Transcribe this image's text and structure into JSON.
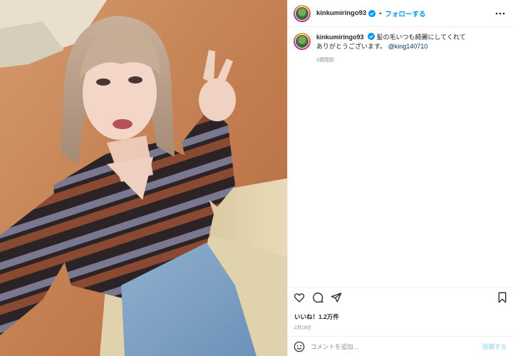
{
  "post": {
    "username": "kinkumiringo93",
    "follow_label": "フォローする",
    "separator": "•",
    "caption_line1": "髪の毛いつも綺麗にしてくれて",
    "caption_line2": "ありがとうございます。",
    "caption_mention": "@king140710",
    "caption_time": "3週間前",
    "likes": "いいね！1.2万件",
    "date": "2月18日",
    "comment_placeholder": "コメントを追加...",
    "post_label": "投稿する"
  },
  "icons": {
    "verified": "verified-badge-icon",
    "more": "more-options-icon",
    "like": "heart-icon",
    "comment": "comment-icon",
    "share": "share-icon",
    "save": "bookmark-icon",
    "emoji": "emoji-icon"
  },
  "colors": {
    "accent": "#0095f6",
    "verified": "#0095f6",
    "mention": "#00376b",
    "muted": "#8e8e8e",
    "text": "#262626"
  }
}
